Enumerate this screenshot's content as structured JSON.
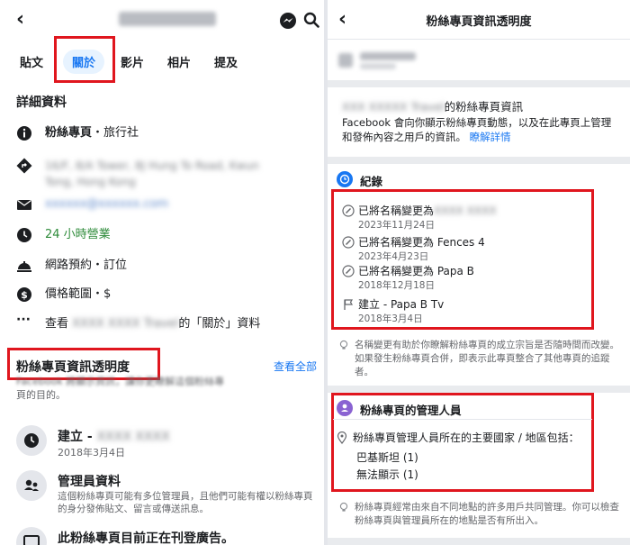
{
  "left": {
    "tabs": [
      "貼文",
      "關於",
      "影片",
      "相片",
      "提及"
    ],
    "active_tab": "關於",
    "section_title": "詳細資料",
    "details": {
      "category_prefix": "粉絲專頁",
      "category_suffix": "・旅行社",
      "address_line1": "16/F, 8/A Tower, 8J Hung To Road, Kwun",
      "address_line2": "Tong, Hong Kong",
      "email": "xxxxxx@xxxxxx.com",
      "hours": "24 小時營業",
      "booking": "網路預約・訂位",
      "price": "價格範圍・$",
      "see_about_prefix": "查看",
      "see_about_blur": "XXXX XXXX Travel",
      "see_about_suffix": "的「關於」資料"
    },
    "transparency_title": "粉絲專頁資訊透明度",
    "see_all": "查看全部",
    "transparency_desc_blur": "Facebook 將顯示資訊，讓你更瞭解這個粉絲專",
    "transparency_desc_tail": "頁的目的。",
    "created_label": "建立 -",
    "created_blur": "XXXX XXXX",
    "created_date": "2018年3月4日",
    "admin_title": "管理員資料",
    "admin_desc": "這個粉絲專頁可能有多位管理員，且他們可能有權以粉絲專頁的身分發佈貼文、留言或傳送訊息。",
    "ads_title": "此粉絲專頁目前正在刊登廣告。"
  },
  "right": {
    "title": "粉絲專頁資訊透明度",
    "page_name_blur": "XXX XXXXX Travel",
    "page_info_suffix": "的粉絲專頁資訊",
    "desc": "Facebook 會向你顯示粉絲專頁動態，以及在此專頁上管理和發佈內容之用戶的資訊。",
    "learn_more": "瞭解詳情",
    "records_title": "紀錄",
    "records": [
      {
        "action": "已將名稱變更為",
        "value": "",
        "value_blur": "XXXX XXXX",
        "date": "2023年11月24日",
        "icon": "pencil-icon"
      },
      {
        "action": "已將名稱變更為",
        "value": "Fences 4",
        "value_blur": "",
        "date": "2023年4月23日",
        "icon": "pencil-icon"
      },
      {
        "action": "已將名稱變更為",
        "value": "Papa B",
        "value_blur": "",
        "date": "2018年12月18日",
        "icon": "pencil-icon"
      },
      {
        "action": "建立 - ",
        "value": "Papa B Tv",
        "value_blur": "",
        "date": "2018年3月4日",
        "icon": "flag-icon"
      }
    ],
    "records_note": "名稱變更有助於你瞭解粉絲專頁的成立宗旨是否隨時間而改變。如果發生粉絲專頁合併，即表示此專頁整合了其他專頁的追蹤者。",
    "admins_title": "粉絲專頁的管理人員",
    "admins_heading": "粉絲專頁管理人員所在的主要國家 / 地區包括：",
    "admins_countries": [
      "巴基斯坦 (1)",
      "無法顯示 (1)"
    ],
    "admins_note": "粉絲專頁經常由來自不同地點的許多用戶共同管理。你可以檢查粉絲專頁與管理員所在的地點是否有所出入。"
  },
  "colors": {
    "accent": "#1877f2",
    "highlight_box": "#e0161e",
    "hours_green": "#2e8b3a",
    "records_badge": "#1877f2",
    "admins_badge": "#8a63d2"
  }
}
